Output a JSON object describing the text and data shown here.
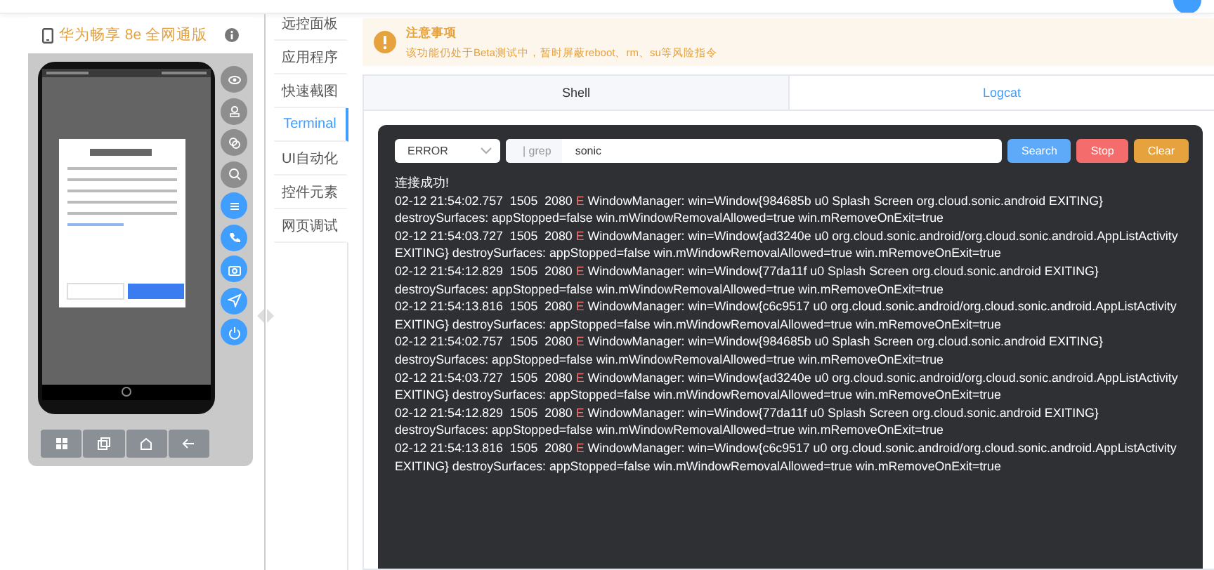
{
  "device": {
    "title": "华为畅享 8e 全网通版"
  },
  "side_tools": [
    {
      "enabled": false
    },
    {
      "enabled": false
    },
    {
      "enabled": false
    },
    {
      "enabled": false
    },
    {
      "enabled": true
    },
    {
      "enabled": true
    },
    {
      "enabled": true
    },
    {
      "enabled": true
    },
    {
      "enabled": true
    }
  ],
  "nav": [
    {
      "label": "远控面板",
      "selected": false
    },
    {
      "label": "应用程序",
      "selected": false
    },
    {
      "label": "快速截图",
      "selected": false
    },
    {
      "label": "Terminal",
      "selected": true
    },
    {
      "label": "UI自动化",
      "selected": false
    },
    {
      "label": "控件元素",
      "selected": false
    },
    {
      "label": "网页调试",
      "selected": false
    }
  ],
  "alert": {
    "title": "注意事项",
    "message": "该功能仍处于Beta测试中，暂时屏蔽reboot、rm、su等风险指令"
  },
  "tabs": [
    {
      "label": "Shell",
      "selected": false
    },
    {
      "label": "Logcat",
      "selected": true
    }
  ],
  "filter": {
    "level": "ERROR",
    "prefix": "| grep",
    "value": "sonic"
  },
  "buttons": [
    {
      "label": "Search",
      "kind": "primary"
    },
    {
      "label": "Stop",
      "kind": "danger"
    },
    {
      "label": "Clear",
      "kind": "warning"
    }
  ],
  "log": {
    "status": "连接成功!",
    "entries": [
      {
        "time": "02-12 21:54:02.757",
        "pid": "1505",
        "tid": "2080",
        "level": "E",
        "message": "WindowManager: win=Window{984685b u0 Splash Screen org.cloud.sonic.android EXITING} destroySurfaces: appStopped=false win.mWindowRemovalAllowed=true win.mRemoveOnExit=true"
      },
      {
        "time": "02-12 21:54:03.727",
        "pid": "1505",
        "tid": "2080",
        "level": "E",
        "message": "WindowManager: win=Window{ad3240e u0 org.cloud.sonic.android/org.cloud.sonic.android.AppListActivity EXITING} destroySurfaces: appStopped=false win.mWindowRemovalAllowed=true win.mRemoveOnExit=true"
      },
      {
        "time": "02-12 21:54:12.829",
        "pid": "1505",
        "tid": "2080",
        "level": "E",
        "message": "WindowManager: win=Window{77da11f u0 Splash Screen org.cloud.sonic.android EXITING} destroySurfaces: appStopped=false win.mWindowRemovalAllowed=true win.mRemoveOnExit=true"
      },
      {
        "time": "02-12 21:54:13.816",
        "pid": "1505",
        "tid": "2080",
        "level": "E",
        "message": "WindowManager: win=Window{c6c9517 u0 org.cloud.sonic.android/org.cloud.sonic.android.AppListActivity EXITING} destroySurfaces: appStopped=false win.mWindowRemovalAllowed=true win.mRemoveOnExit=true"
      },
      {
        "time": "02-12 21:54:02.757",
        "pid": "1505",
        "tid": "2080",
        "level": "E",
        "message": "WindowManager: win=Window{984685b u0 Splash Screen org.cloud.sonic.android EXITING} destroySurfaces: appStopped=false win.mWindowRemovalAllowed=true win.mRemoveOnExit=true"
      },
      {
        "time": "02-12 21:54:03.727",
        "pid": "1505",
        "tid": "2080",
        "level": "E",
        "message": "WindowManager: win=Window{ad3240e u0 org.cloud.sonic.android/org.cloud.sonic.android.AppListActivity EXITING} destroySurfaces: appStopped=false win.mWindowRemovalAllowed=true win.mRemoveOnExit=true"
      },
      {
        "time": "02-12 21:54:12.829",
        "pid": "1505",
        "tid": "2080",
        "level": "E",
        "message": "WindowManager: win=Window{77da11f u0 Splash Screen org.cloud.sonic.android EXITING} destroySurfaces: appStopped=false win.mWindowRemovalAllowed=true win.mRemoveOnExit=true"
      },
      {
        "time": "02-12 21:54:13.816",
        "pid": "1505",
        "tid": "2080",
        "level": "E",
        "message": "WindowManager: win=Window{c6c9517 u0 org.cloud.sonic.android/org.cloud.sonic.android.AppListActivity EXITING} destroySurfaces: appStopped=false win.mWindowRemovalAllowed=true win.mRemoveOnExit=true"
      }
    ]
  }
}
